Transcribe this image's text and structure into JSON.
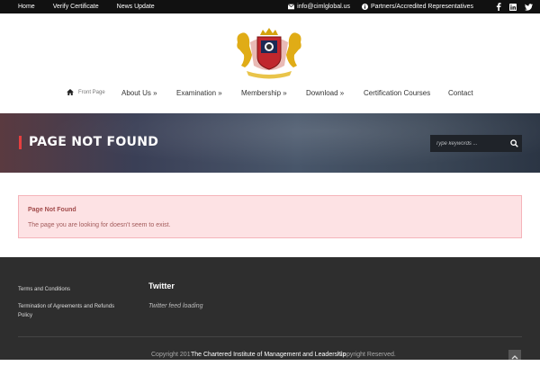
{
  "topbar": {
    "links": [
      "Home",
      "Verify Certificate",
      "News Update"
    ],
    "email": "info@cimlglobal.us",
    "partners": "Partners/Accredited Representatives",
    "social_icons": [
      "facebook-icon",
      "linkedin-icon",
      "twitter-icon"
    ]
  },
  "nav": {
    "home_label": "Front Page",
    "items": [
      "About Us »",
      "Examination »",
      "Membership »",
      "Download »",
      "Certification Courses",
      "Contact"
    ]
  },
  "banner": {
    "title": "PAGE NOT FOUND",
    "search_placeholder": "Type keywords ...",
    "accent": "#e63f3f"
  },
  "alert": {
    "heading": "Page Not Found",
    "message": "The page you are looking for doesn't seem to exist."
  },
  "footer": {
    "links": [
      "Terms and Conditions",
      "Termination of Agreements and Refunds Policy"
    ],
    "twitter_title": "Twitter",
    "twitter_status": "Twitter feed loading",
    "copy_left": "Copyright 201",
    "copy_org": "The Chartered Institute of Management and Leadership",
    "copy_right": "Copyright Reserved."
  }
}
